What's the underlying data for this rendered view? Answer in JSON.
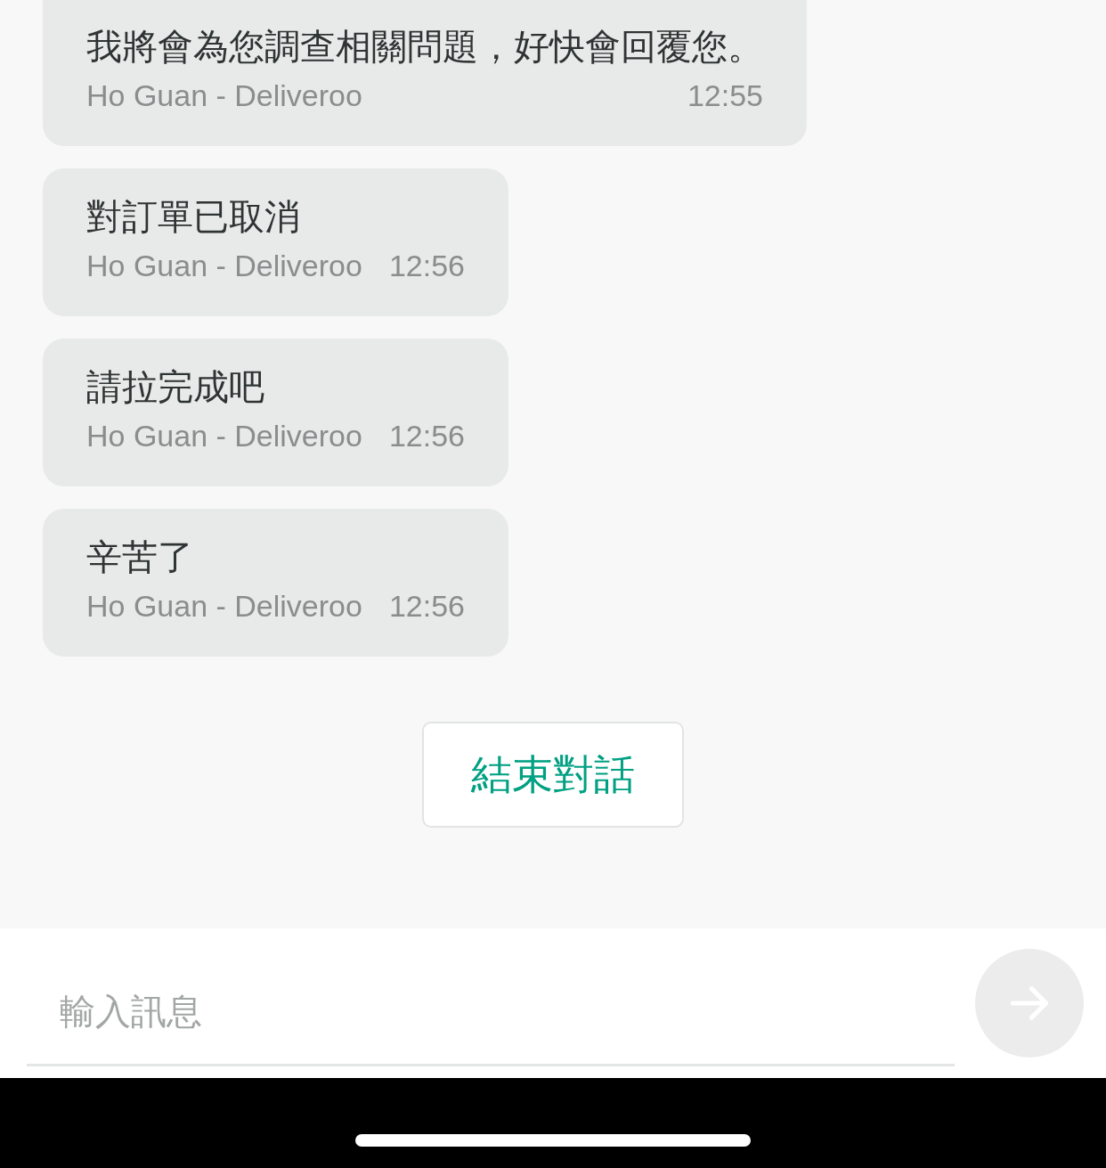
{
  "messages": [
    {
      "text": "我將會為您調查相關問題，好快會回覆您。",
      "sender": "Ho Guan - Deliveroo",
      "time": "12:55"
    },
    {
      "text": "對訂單已取消",
      "sender": "Ho Guan - Deliveroo",
      "time": "12:56"
    },
    {
      "text": "請拉完成吧",
      "sender": "Ho Guan - Deliveroo",
      "time": "12:56"
    },
    {
      "text": "辛苦了",
      "sender": "Ho Guan - Deliveroo",
      "time": "12:56"
    }
  ],
  "end_button": "結束對話",
  "composer": {
    "placeholder": "輸入訊息"
  }
}
